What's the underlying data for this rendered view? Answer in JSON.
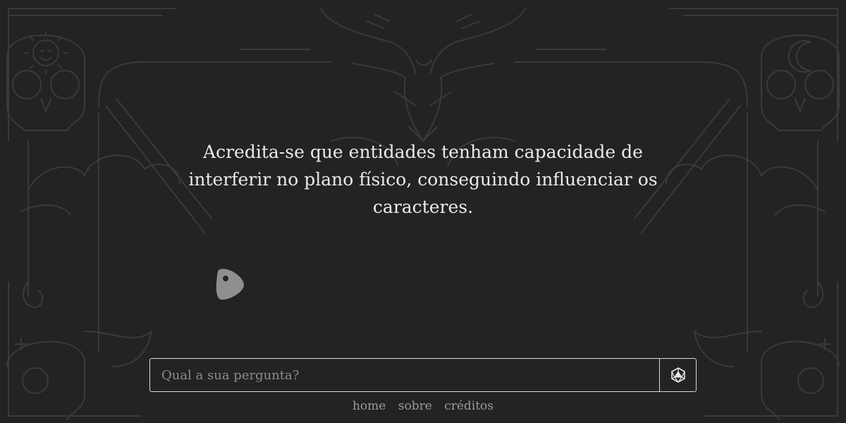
{
  "message": {
    "line1": "Acredita-se que entidades tenham capacidade de",
    "line2": "interferir no plano físico, conseguindo influenciar os",
    "line3": "caracteres."
  },
  "question": {
    "placeholder": "Qual a sua pergunta?",
    "value": ""
  },
  "submit": {
    "icon": "d20-dice-icon"
  },
  "nav": {
    "home": "home",
    "sobre": "sobre",
    "creditos": "créditos"
  },
  "colors": {
    "background": "#232323",
    "ornament": "#3a3a3a",
    "text": "#eaeaea",
    "muted": "#9a9a9a",
    "planchette": "#8f8f8f"
  }
}
